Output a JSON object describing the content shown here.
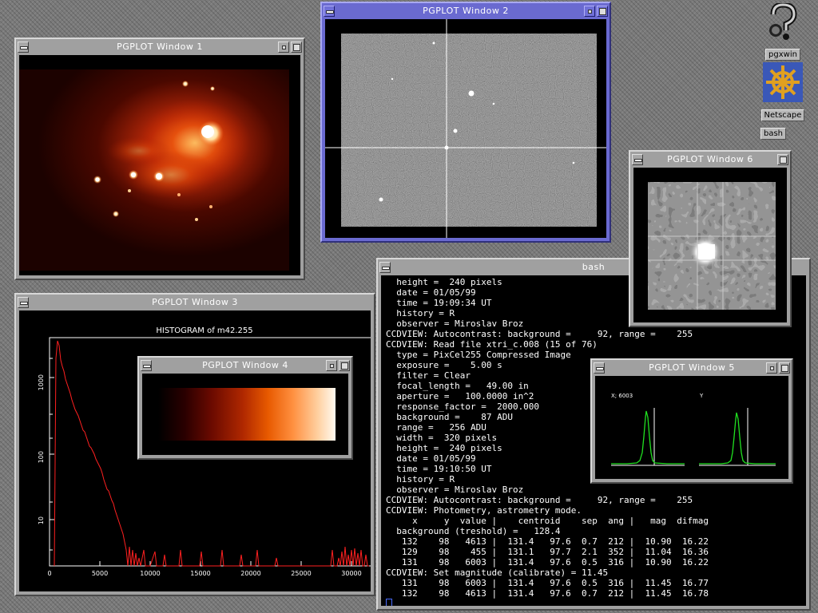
{
  "desktop": {
    "icons": [
      {
        "label": "pgxwin"
      },
      {
        "label": "Netscape"
      },
      {
        "label": "bash"
      }
    ]
  },
  "windows": {
    "pg1": {
      "title": "PGPLOT Window 1"
    },
    "pg2": {
      "title": "PGPLOT Window 2"
    },
    "pg3": {
      "title": "PGPLOT Window 3",
      "plot_title": "HISTOGRAM of m42.255",
      "x_ticks": [
        "0",
        "5000",
        "10000",
        "15000",
        "20000",
        "25000",
        "30000"
      ],
      "y_ticks": [
        "1000",
        "100",
        "10"
      ]
    },
    "pg4": {
      "title": "PGPLOT Window 4"
    },
    "pg5": {
      "title": "PGPLOT Window 5",
      "label_x": "X; 6003",
      "label_y": "Y"
    },
    "pg6": {
      "title": "PGPLOT Window 6"
    },
    "bash": {
      "title": "bash",
      "lines": [
        "  height =  240 pixels",
        "  date = 01/05/99",
        "  time = 19:09:34 UT",
        "  history = R",
        "  observer = Miroslav Broz",
        "CCDVIEW: Autocontrast: background =     92, range =    255",
        "CCDVIEW: Read file xtri_c.008 (15 of 76)",
        "  type = PixCel255 Compressed Image",
        "  exposure =    5.00 s",
        "  filter = Clear",
        "  focal_length =   49.00 in",
        "  aperture =   100.0000 in^2",
        "  response_factor =  2000.000",
        "  background =    87 ADU",
        "  range =   256 ADU",
        "  width =  320 pixels",
        "  height =  240 pixels",
        "  date = 01/05/99",
        "  time = 19:10:50 UT",
        "  history = R",
        "  observer = Miroslav Broz",
        "CCDVIEW: Autocontrast: background =     92, range =    255",
        "CCDVIEW: Photometry, astrometry mode.",
        "     x     y  value |    centroid    sep  ang |   mag  difmag",
        "  background (treshold) =   128.4",
        "   132    98   4613 |  131.4   97.6  0.7  212 |  10.90  16.22",
        "   129    98    455 |  131.1   97.7  2.1  352 |  11.04  16.36",
        "   131    98   6003 |  131.4   97.6  0.5  316 |  10.90  16.22",
        "CCDVIEW: Set magnitude (calibrate) = 11.45",
        "   131    98   6003 |  131.4   97.6  0.5  316 |  11.45  16.77",
        "   132    98   4613 |  131.4   97.6  0.7  212 |  11.45  16.78"
      ]
    }
  }
}
